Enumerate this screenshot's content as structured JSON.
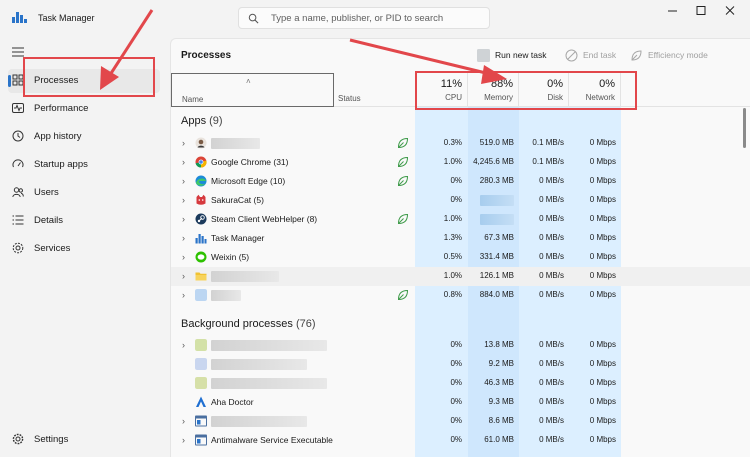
{
  "window": {
    "title": "Task Manager",
    "search_placeholder": "Type a name, publisher, or PID to search"
  },
  "sidebar": {
    "items": [
      {
        "label": "Processes",
        "icon": "grid-icon",
        "active": true
      },
      {
        "label": "Performance",
        "icon": "pulse-icon"
      },
      {
        "label": "App history",
        "icon": "history-icon"
      },
      {
        "label": "Startup apps",
        "icon": "speedometer-icon"
      },
      {
        "label": "Users",
        "icon": "users-icon"
      },
      {
        "label": "Details",
        "icon": "list-icon"
      },
      {
        "label": "Services",
        "icon": "puzzle-icon"
      }
    ],
    "settings_label": "Settings"
  },
  "main": {
    "title": "Processes",
    "toolbar": {
      "run_new_task": "Run new task",
      "end_task": "End task",
      "efficiency_mode": "Efficiency mode"
    },
    "columns": {
      "name": "Name",
      "status": "Status",
      "cpu": {
        "pct": "11%",
        "label": "CPU"
      },
      "memory": {
        "pct": "88%",
        "label": "Memory"
      },
      "disk": {
        "pct": "0%",
        "label": "Disk"
      },
      "network": {
        "pct": "0%",
        "label": "Network"
      }
    },
    "apps_section": {
      "label": "Apps",
      "count": "(9)"
    },
    "background_section": {
      "label": "Background processes",
      "count": "(76)"
    },
    "apps": [
      {
        "name": "",
        "icon": "avatar-icon",
        "leaf": true,
        "cpu": "0.3%",
        "memory": "519.0 MB",
        "disk": "0.1 MB/s",
        "network": "0 Mbps"
      },
      {
        "name": "Google Chrome (31)",
        "icon": "chrome-icon",
        "leaf": true,
        "cpu": "1.0%",
        "memory": "4,245.6 MB",
        "disk": "0.1 MB/s",
        "network": "0 Mbps"
      },
      {
        "name": "Microsoft Edge (10)",
        "icon": "edge-icon",
        "leaf": true,
        "cpu": "0%",
        "memory": "280.3 MB",
        "disk": "0 MB/s",
        "network": "0 Mbps"
      },
      {
        "name": "SakuraCat (5)",
        "icon": "sakuracat-icon",
        "leaf": false,
        "cpu": "0%",
        "memory": "",
        "disk": "0 MB/s",
        "network": "0 Mbps"
      },
      {
        "name": "Steam Client WebHelper (8)",
        "icon": "steam-icon",
        "leaf": true,
        "cpu": "1.0%",
        "memory": "",
        "disk": "0 MB/s",
        "network": "0 Mbps"
      },
      {
        "name": "Task Manager",
        "icon": "taskmanager-icon",
        "leaf": false,
        "cpu": "1.3%",
        "memory": "67.3 MB",
        "disk": "0 MB/s",
        "network": "0 Mbps"
      },
      {
        "name": "Weixin (5)",
        "icon": "wechat-icon",
        "leaf": false,
        "cpu": "0.5%",
        "memory": "331.4 MB",
        "disk": "0 MB/s",
        "network": "0 Mbps"
      },
      {
        "name": "",
        "icon": "folder-icon",
        "leaf": false,
        "cpu": "1.0%",
        "memory": "126.1 MB",
        "disk": "0 MB/s",
        "network": "0 Mbps"
      },
      {
        "name": "",
        "icon": "app-icon",
        "leaf": true,
        "cpu": "0.8%",
        "memory": "884.0 MB",
        "disk": "0 MB/s",
        "network": "0 Mbps"
      }
    ],
    "background": [
      {
        "name": "",
        "icon": "app-icon",
        "cpu": "0%",
        "memory": "13.8 MB",
        "disk": "0 MB/s",
        "network": "0 Mbps"
      },
      {
        "name": "",
        "icon": "app-icon",
        "cpu": "0%",
        "memory": "9.2 MB",
        "disk": "0 MB/s",
        "network": "0 Mbps"
      },
      {
        "name": "",
        "icon": "app-icon",
        "cpu": "0%",
        "memory": "46.3 MB",
        "disk": "0 MB/s",
        "network": "0 Mbps"
      },
      {
        "name": "Aha Doctor",
        "icon": "aha-doctor-icon",
        "cpu": "0%",
        "memory": "9.3 MB",
        "disk": "0 MB/s",
        "network": "0 Mbps"
      },
      {
        "name": "",
        "icon": "window-icon",
        "cpu": "0%",
        "memory": "8.6 MB",
        "disk": "0 MB/s",
        "network": "0 Mbps"
      },
      {
        "name": "Antimalware Service Executable",
        "icon": "window-icon",
        "cpu": "0%",
        "memory": "61.0 MB",
        "disk": "0 MB/s",
        "network": "0 Mbps"
      }
    ]
  },
  "colors": {
    "accent": "#2a74c9",
    "annotation_red": "#e2474b",
    "column_tint_light": "#dcefff",
    "column_tint_dark": "#bfe0fb"
  }
}
